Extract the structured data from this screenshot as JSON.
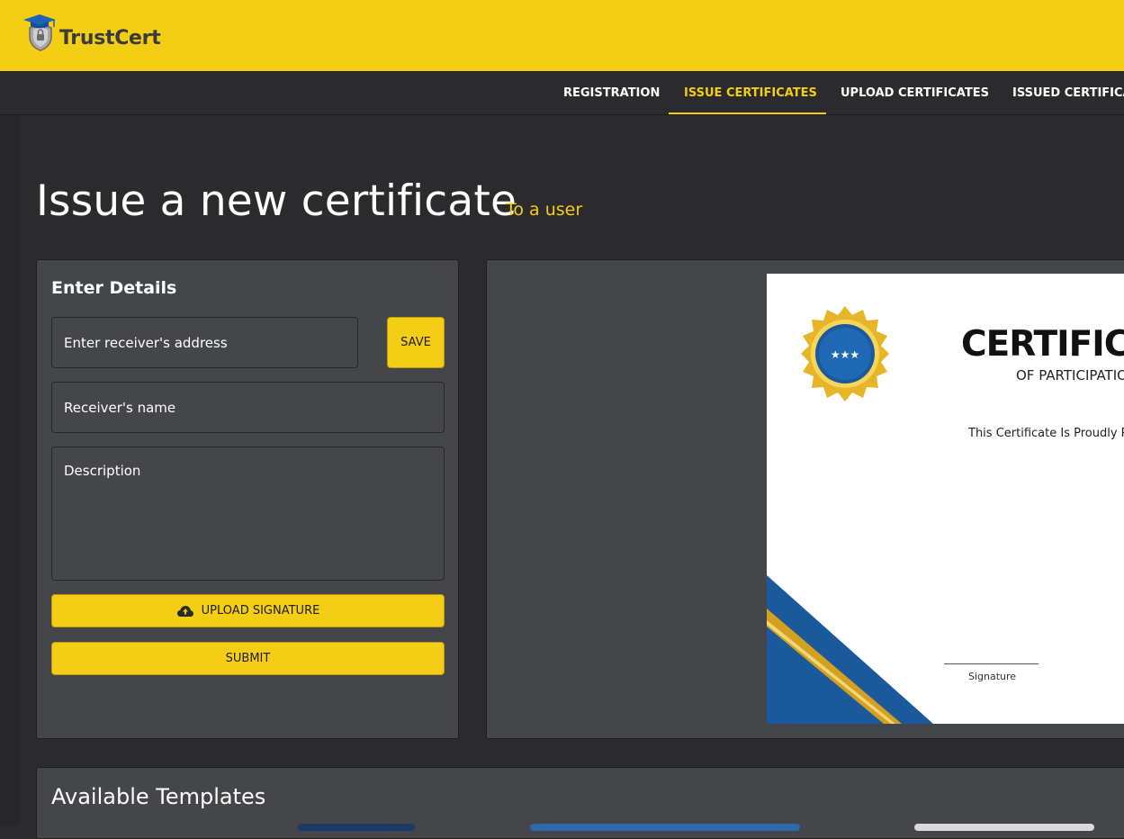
{
  "header": {
    "brand": "TrustCert",
    "logo_icon": "shield-graduation-cap-icon"
  },
  "nav": {
    "items": [
      {
        "label": "REGISTRATION",
        "active": false
      },
      {
        "label": "ISSUE CERTIFICATES",
        "active": true
      },
      {
        "label": "UPLOAD CERTIFICATES",
        "active": false
      },
      {
        "label": "ISSUED CERTIFICATES",
        "active": false
      }
    ]
  },
  "page": {
    "title": "Issue a new certificate",
    "subtitle": "To a user"
  },
  "form": {
    "heading": "Enter Details",
    "address_placeholder": "Enter receiver's address",
    "save_label": "SAVE",
    "name_placeholder": "Receiver's name",
    "description_placeholder": "Description",
    "upload_label": "UPLOAD SIGNATURE",
    "upload_icon": "cloud-upload-icon",
    "submit_label": "SUBMIT"
  },
  "preview": {
    "title": "CERTIFICATE",
    "subtitle": "OF PARTICIPATION",
    "presented_line": "This Certificate Is Proudly Presented To",
    "signature_label": "Signature",
    "seal_icon": "gold-star-seal-icon"
  },
  "templates": {
    "heading": "Available Templates"
  },
  "colors": {
    "accent": "#f4ce14",
    "background": "#2b2b2d",
    "card": "#454649",
    "cert_blue": "#1a5a9c",
    "cert_gold": "#d4a020"
  }
}
